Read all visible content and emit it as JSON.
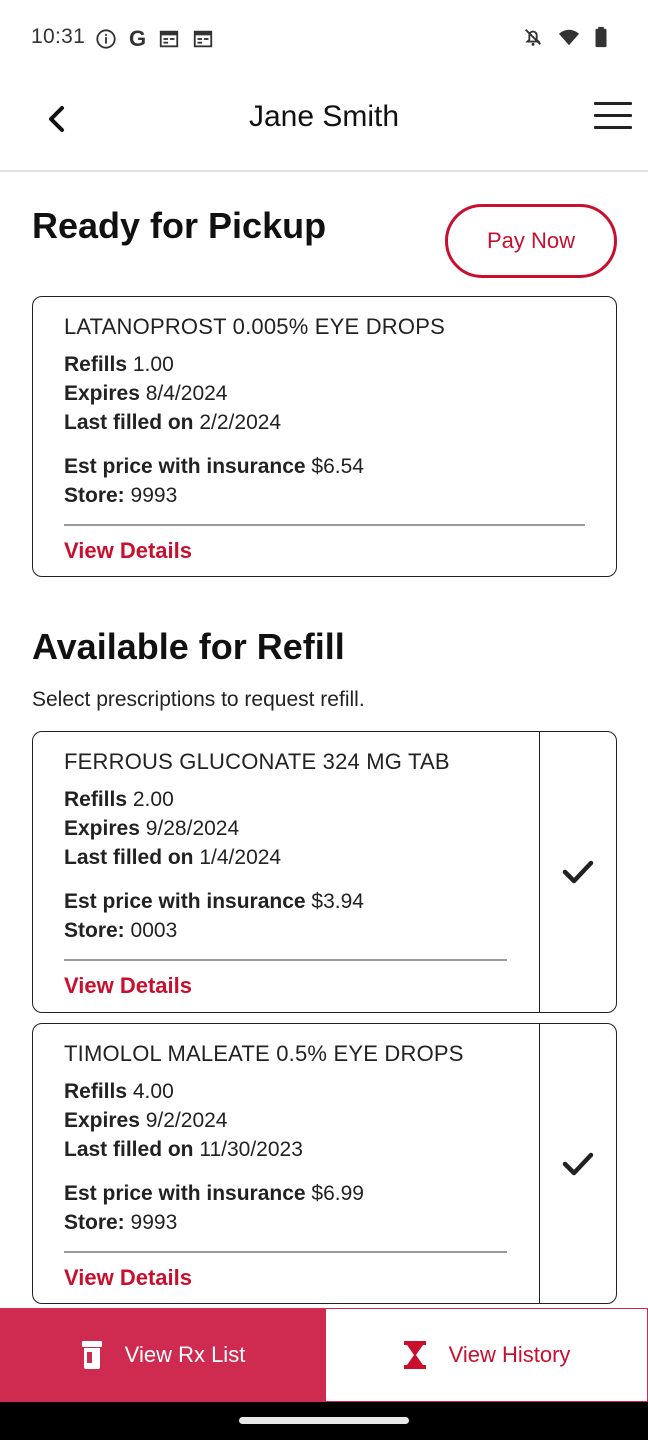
{
  "status_bar": {
    "time": "10:31",
    "left_icons": [
      "info-icon",
      "google-icon",
      "calendar-icon",
      "calendar-icon"
    ],
    "g_letter": "G",
    "right_icons": [
      "bell-off-icon",
      "wifi-icon",
      "battery-icon"
    ]
  },
  "header": {
    "title": "Jane Smith",
    "back_icon": "chevron-left-icon",
    "menu_icon": "hamburger-menu-icon"
  },
  "ready": {
    "title": "Ready for Pickup",
    "pay_now_label": "Pay Now",
    "items": [
      {
        "drug_name": "LATANOPROST 0.005% EYE DROPS",
        "refills_label": "Refills",
        "refills": "1.00",
        "expires_label": "Expires",
        "expires": "8/4/2024",
        "last_filled_label": "Last filled on",
        "last_filled": "2/2/2024",
        "price_label": "Est price with insurance",
        "price": "$6.54",
        "store_label": "Store:",
        "store": "9993",
        "details_label": "View Details"
      }
    ]
  },
  "refill": {
    "title": "Available for Refill",
    "subtitle": "Select prescriptions to request refill.",
    "items": [
      {
        "drug_name": "FERROUS GLUCONATE 324 MG TAB",
        "refills_label": "Refills",
        "refills": "2.00",
        "expires_label": "Expires",
        "expires": "9/28/2024",
        "last_filled_label": "Last filled on",
        "last_filled": "1/4/2024",
        "price_label": "Est price with insurance",
        "price": "$3.94",
        "store_label": "Store:",
        "store": "0003",
        "details_label": "View Details",
        "checked": true
      },
      {
        "drug_name": "TIMOLOL MALEATE 0.5% EYE DROPS",
        "refills_label": "Refills",
        "refills": "4.00",
        "expires_label": "Expires",
        "expires": "9/2/2024",
        "last_filled_label": "Last filled on",
        "last_filled": "11/30/2023",
        "price_label": "Est price with insurance",
        "price": "$6.99",
        "store_label": "Store:",
        "store": "9993",
        "details_label": "View Details",
        "checked": true
      }
    ]
  },
  "bottom_bar": {
    "rx_list_label": "View Rx List",
    "rx_list_icon": "pill-bottle-icon",
    "history_label": "View History",
    "history_icon": "hourglass-icon"
  },
  "colors": {
    "brand_red": "#c8102e",
    "tab_active_bg": "#cf2a4f"
  }
}
